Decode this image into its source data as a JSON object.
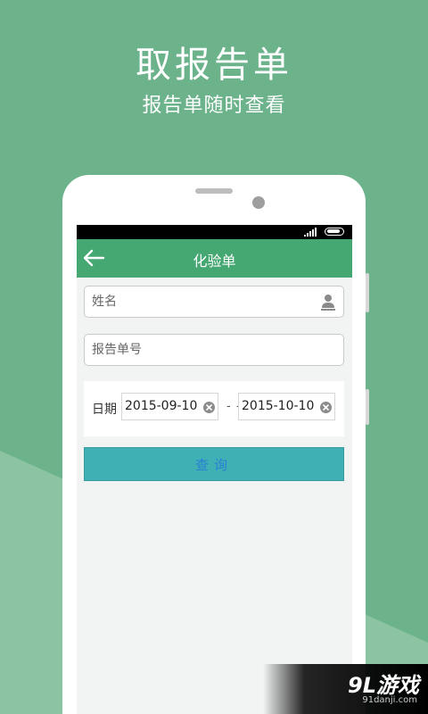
{
  "promo": {
    "title": "取报告单",
    "subtitle": "报告单随时查看"
  },
  "app": {
    "title": "化验单",
    "name_placeholder": "姓名",
    "report_no_placeholder": "报告单号",
    "date_label": "日期",
    "start_date": "2015-09-10",
    "date_separator": "- -",
    "end_date": "2015-10-10",
    "query_label": "查询"
  },
  "watermark": {
    "logo": "9L游戏",
    "url": "91danji.com"
  },
  "colors": {
    "background": "#6cb38b",
    "appbar": "#45a772",
    "button": "#3fb1b4",
    "button_text": "#2a7fd4"
  }
}
